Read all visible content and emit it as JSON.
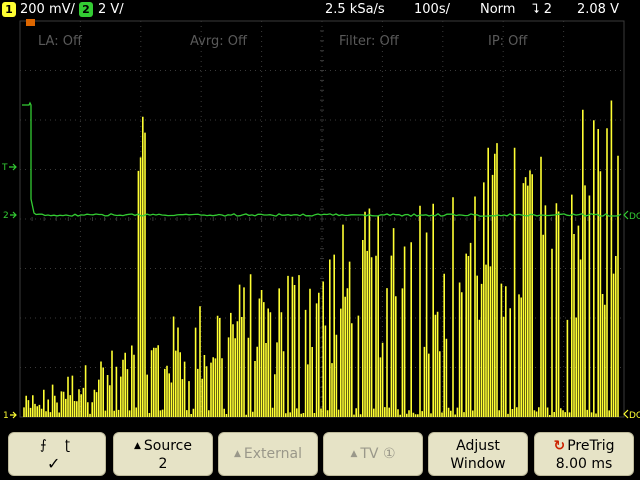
{
  "status": {
    "ch1_badge": "1",
    "ch1_scale": "200 mV/",
    "ch2_badge": "2",
    "ch2_scale": "2 V/",
    "sample_rate": "2.5 kSa/s",
    "timebase": "100s/",
    "trigger_mode": "Norm",
    "trigger_source": "⮧ 2",
    "trigger_level": "2.08  V"
  },
  "overlays": {
    "la": "LA: Off",
    "avg": "Avrg: Off",
    "filter": "Filter: Off",
    "ip": "IP: Off"
  },
  "markers": {
    "trigger_marker": "T",
    "ch2_marker": "2",
    "ch1_marker": "1",
    "dc_right_2": "DC",
    "dc_right_1": "DC"
  },
  "softkeys": {
    "slope_check": "✓",
    "source_label": "Source",
    "source_value": "2",
    "external_label": "External",
    "tv_label": "TV",
    "tv_badge": "①",
    "adjust_line1": "Adjust",
    "adjust_line2": "Window",
    "pretrig_label": "PreTrig",
    "pretrig_value": "8.00 ms"
  },
  "colors": {
    "ch1": "#ffff33",
    "ch2": "#33cc33",
    "grid": "#3a3a3a",
    "softkey_bg": "#e6e3c6"
  },
  "icons": {
    "rising_edge": "rising-edge-icon",
    "falling_edge": "falling-edge-icon",
    "pretrig": "rotate-arrow-icon"
  }
}
